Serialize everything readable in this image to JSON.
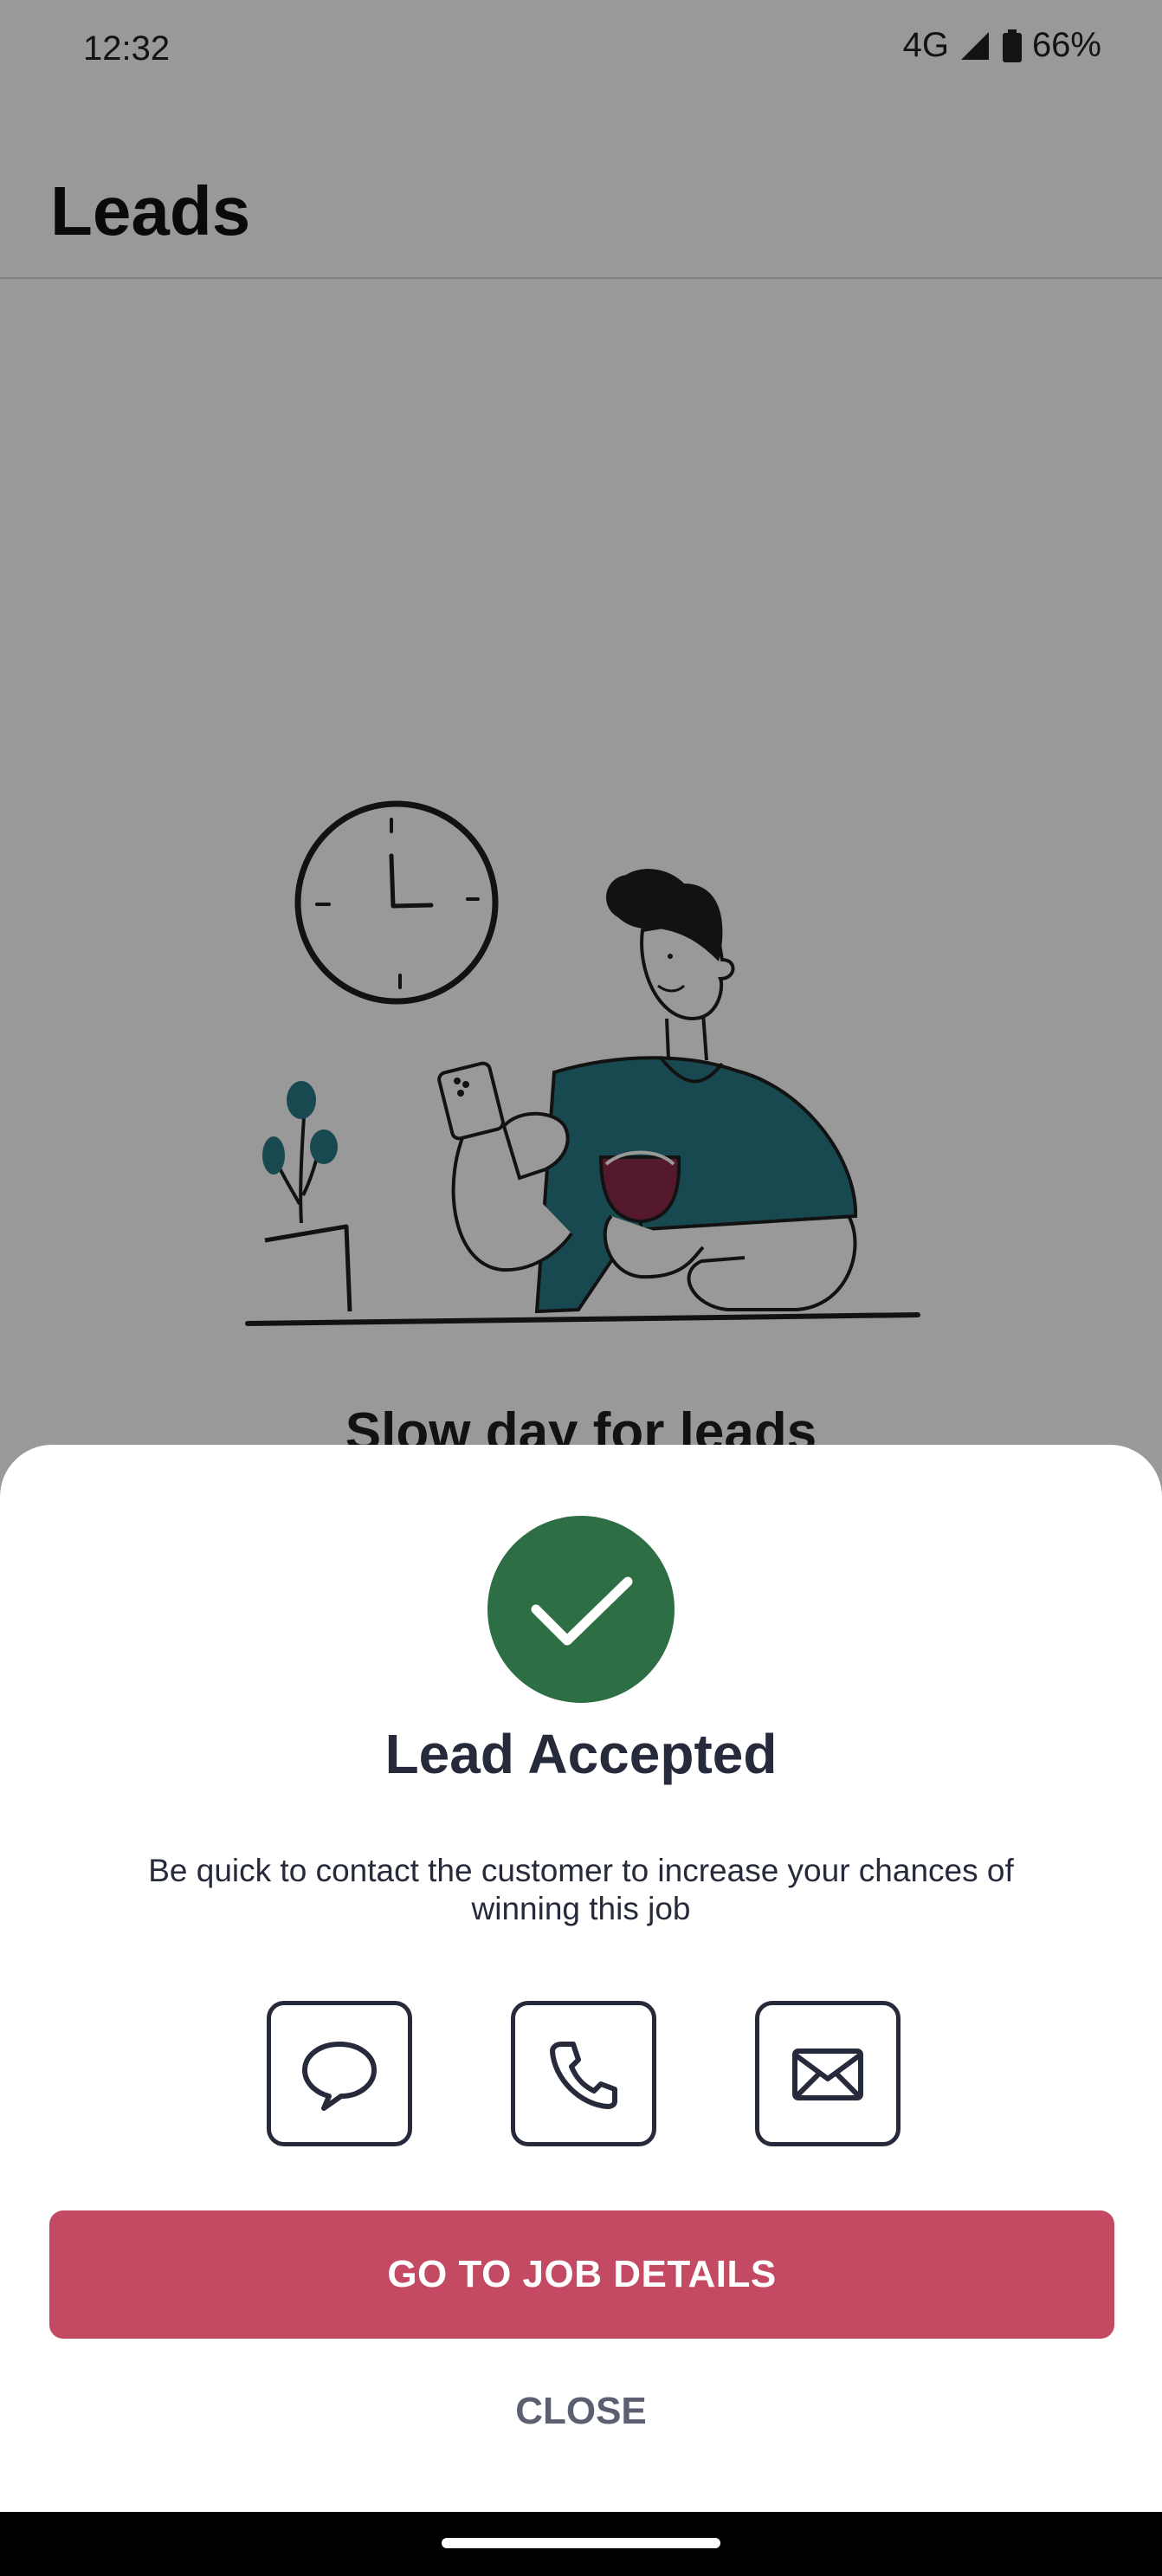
{
  "status_bar": {
    "time": "12:32",
    "network": "4G",
    "battery": "66%"
  },
  "app_bar": {
    "title": "Leads"
  },
  "empty_state": {
    "title": "Slow day for leads"
  },
  "sheet": {
    "title": "Lead Accepted",
    "body": "Be quick to contact the customer to increase your chances of winning this job",
    "contact_actions": [
      {
        "icon": "chat-bubble-icon"
      },
      {
        "icon": "phone-icon"
      },
      {
        "icon": "mail-icon"
      }
    ],
    "primary_button": "GO TO JOB DETAILS",
    "close_button": "CLOSE"
  },
  "colors": {
    "success": "#2e6e45",
    "primary": "#c34a62",
    "text_dark": "#262a3a",
    "illustration_teal": "#2b7a86",
    "illustration_wine": "#8e2a4a"
  }
}
